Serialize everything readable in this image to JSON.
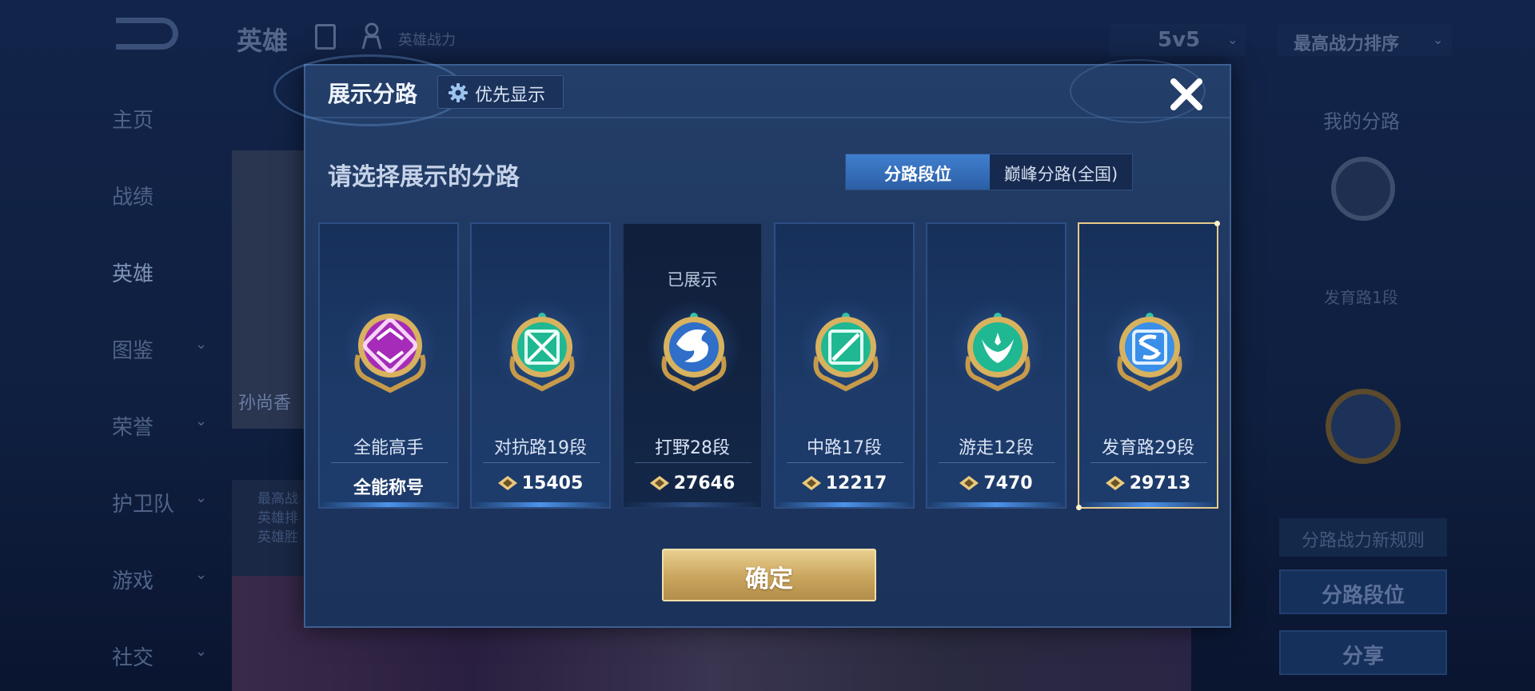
{
  "background": {
    "top_title": "英雄",
    "top_subtitle": "英雄战力",
    "mode_select": "5v5",
    "sort_select": "最高战力排序",
    "nav": [
      "主页",
      "战绩",
      "英雄",
      "图鉴",
      "荣誉",
      "护卫队",
      "游戏",
      "社交"
    ],
    "hero_name": "孙尚香",
    "hero_info_lines": [
      "最高战",
      "英雄排",
      "英雄胜"
    ],
    "right_title": "我的分路",
    "right_lane_text": "发育路1段",
    "right_rule": "分路战力新规则",
    "right_btn_lane": "分路段位",
    "right_btn_share": "分享"
  },
  "modal": {
    "title": "展示分路",
    "priority_button": "优先显示",
    "prompt": "请选择展示的分路",
    "tabs": [
      {
        "label": "分路段位",
        "active": true
      },
      {
        "label": "巅峰分路(全国)",
        "active": false
      }
    ],
    "confirm": "确定",
    "cards": [
      {
        "rank": "全能高手",
        "power": "全能称号",
        "shown": false,
        "selected": false,
        "badge": "all-round-badge-icon",
        "color": "#b636c8"
      },
      {
        "rank": "对抗路19段",
        "power": "15405",
        "shown": false,
        "selected": false,
        "badge": "clash-lane-badge-icon",
        "color": "#1fbf9a"
      },
      {
        "rank": "打野28段",
        "power": "27646",
        "shown": true,
        "shown_label": "已展示",
        "selected": false,
        "badge": "jungle-badge-icon",
        "color": "#3b7fd8"
      },
      {
        "rank": "中路17段",
        "power": "12217",
        "shown": false,
        "selected": false,
        "badge": "mid-lane-badge-icon",
        "color": "#1fbf9a"
      },
      {
        "rank": "游走12段",
        "power": "7470",
        "shown": false,
        "selected": false,
        "badge": "roam-badge-icon",
        "color": "#1fbf9a"
      },
      {
        "rank": "发育路29段",
        "power": "29713",
        "shown": false,
        "selected": true,
        "badge": "farm-lane-badge-icon",
        "color": "#3a8fe8"
      }
    ]
  }
}
